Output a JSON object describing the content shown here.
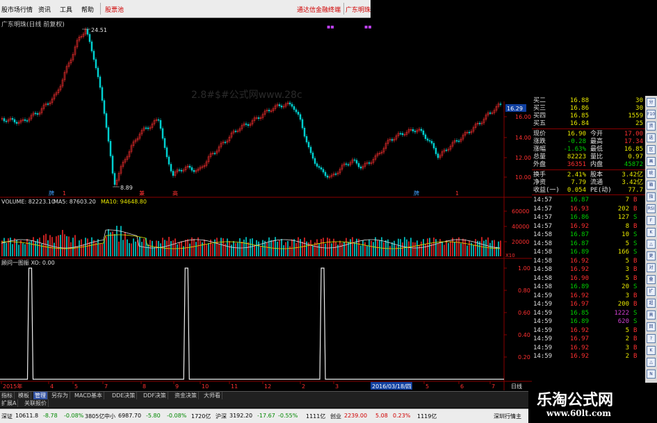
{
  "menubar": {
    "items": [
      "股市场行情",
      "资讯",
      "工具",
      "帮助"
    ],
    "stock_link": "股票池",
    "promo": "通达信金融终端",
    "app_title": "广东明珠"
  },
  "chart_header": {
    "title": "广东明珠(日线 前复权)"
  },
  "watermark_text": "2.8#$#公式网www.28c",
  "price_chart": {
    "high_label": "24.51",
    "low_label": "8.89",
    "current_price_tag": "16.29",
    "y_ticks": [
      "16.00",
      "14.00",
      "12.00",
      "10.00"
    ],
    "markers": [
      {
        "text": "牌",
        "color": "#40a0ff"
      },
      {
        "text": "1",
        "color": "#ff3030"
      },
      {
        "text": "兼",
        "color": "#ff3030"
      },
      {
        "text": "高",
        "color": "#ff3030"
      },
      {
        "text": "牌",
        "color": "#40a0ff"
      },
      {
        "text": "1",
        "color": "#ff3030"
      }
    ]
  },
  "volume_panel": {
    "header_volume": "VOLUME: 82223.10",
    "header_ma5": "MA5: 87603.20",
    "header_ma10": "MA10: 94648.80",
    "y_ticks": [
      "60000",
      "40000",
      "20000"
    ],
    "unit": "X10"
  },
  "indicator_panel": {
    "header": "顾问一图振 XO: 0.00",
    "y_ticks": [
      "1.00",
      "0.80",
      "0.60",
      "0.40",
      "0.20"
    ],
    "peaks": [
      0.06,
      0.37,
      0.64
    ]
  },
  "time_axis": {
    "labels": [
      "2015年",
      "4",
      "5",
      "7",
      "8",
      "9",
      "10",
      "11",
      "12",
      "2",
      "3",
      "2016/03/18/四",
      "5",
      "6",
      "7"
    ],
    "right_label": "日线"
  },
  "quote_panel": {
    "order_book": [
      {
        "label": "买二",
        "price": "16.88",
        "vol": "30"
      },
      {
        "label": "买三",
        "price": "16.86",
        "vol": "30"
      },
      {
        "label": "买四",
        "price": "16.85",
        "vol": "1559"
      },
      {
        "label": "买五",
        "price": "16.84",
        "vol": "25"
      }
    ],
    "stats": [
      {
        "l1": "现价",
        "v1": "16.90",
        "l2": "今开",
        "v2": "17.00"
      },
      {
        "l1": "涨跌",
        "v1": "-0.28",
        "l2": "最高",
        "v2": "17.34"
      },
      {
        "l1": "涨幅",
        "v1": "-1.63%",
        "l2": "最低",
        "v2": "16.85"
      },
      {
        "l1": "总量",
        "v1": "82223",
        "l2": "量比",
        "v2": "0.97"
      },
      {
        "l1": "外盘",
        "v1": "36351",
        "l2": "内盘",
        "v2": "45872"
      }
    ],
    "stats2": [
      {
        "l1": "换手",
        "v1": "2.41%",
        "l2": "股本",
        "v2": "3.42亿"
      },
      {
        "l1": "净资",
        "v1": "7.79",
        "l2": "流通",
        "v2": "3.42亿"
      },
      {
        "l1": "收益(一)",
        "v1": "0.054",
        "l2": "PE(动)",
        "v2": "77.7"
      }
    ],
    "ticks": [
      {
        "t": "14:57",
        "p": "16.87",
        "v": "7",
        "s": "B"
      },
      {
        "t": "14:57",
        "p": "16.93",
        "v": "202",
        "s": "B"
      },
      {
        "t": "14:57",
        "p": "16.86",
        "v": "127",
        "s": "S"
      },
      {
        "t": "14:57",
        "p": "16.92",
        "v": "8",
        "s": "B"
      },
      {
        "t": "14:58",
        "p": "16.87",
        "v": "10",
        "s": "S"
      },
      {
        "t": "14:58",
        "p": "16.87",
        "v": "5",
        "s": "S"
      },
      {
        "t": "14:58",
        "p": "16.89",
        "v": "166",
        "s": "S"
      },
      {
        "t": "14:58",
        "p": "16.92",
        "v": "5",
        "s": "B"
      },
      {
        "t": "14:58",
        "p": "16.92",
        "v": "3",
        "s": "B"
      },
      {
        "t": "14:58",
        "p": "16.90",
        "v": "5",
        "s": "B"
      },
      {
        "t": "14:58",
        "p": "16.89",
        "v": "20",
        "s": "S"
      },
      {
        "t": "14:59",
        "p": "16.92",
        "v": "3",
        "s": "B"
      },
      {
        "t": "14:59",
        "p": "16.97",
        "v": "200",
        "s": "B"
      },
      {
        "t": "14:59",
        "p": "16.85",
        "v": "1222",
        "s": "S"
      },
      {
        "t": "14:59",
        "p": "16.89",
        "v": "620",
        "s": "S"
      },
      {
        "t": "14:59",
        "p": "16.92",
        "v": "5",
        "s": "B"
      },
      {
        "t": "14:59",
        "p": "16.97",
        "v": "2",
        "s": "B"
      },
      {
        "t": "14:59",
        "p": "16.92",
        "v": "3",
        "s": "B"
      },
      {
        "t": "14:59",
        "p": "16.92",
        "v": "2",
        "s": "B"
      }
    ]
  },
  "side_icons": [
    "分",
    "F10",
    "资",
    "选",
    "区",
    "画",
    "统",
    "箱",
    "指",
    "RSI",
    "F",
    "K",
    "△",
    "更",
    "对",
    "叠",
    "扩",
    "超",
    "高",
    "回",
    "?",
    "K",
    "△",
    "N"
  ],
  "tabs_row1": [
    "指标",
    "模板",
    "管理",
    "另存为",
    "MACD基本",
    "DDE决策",
    "DDF决策",
    "资金决策",
    "大师看"
  ],
  "tabs_row1_active": 2,
  "tabs_row2": [
    "扩展A",
    "关联报价"
  ],
  "statusbar": {
    "items": [
      {
        "text": "深证",
        "cls": "k"
      },
      {
        "text": "10611.8",
        "cls": "k"
      },
      {
        "text": "-8.78",
        "cls": "g"
      },
      {
        "text": "-0.08%",
        "cls": "g"
      },
      {
        "text": "3805亿",
        "cls": "k"
      },
      {
        "text": "中小",
        "cls": "k"
      },
      {
        "text": "6987.70",
        "cls": "k"
      },
      {
        "text": "-5.80",
        "cls": "g"
      },
      {
        "text": "-0.08%",
        "cls": "g"
      },
      {
        "text": "1720亿",
        "cls": "k"
      },
      {
        "text": "沪深",
        "cls": "k"
      },
      {
        "text": "3192.20",
        "cls": "k"
      },
      {
        "text": "-17.67",
        "cls": "g"
      },
      {
        "text": "-0.55%",
        "cls": "g"
      },
      {
        "text": "1111亿",
        "cls": "k"
      },
      {
        "text": "创业",
        "cls": "k"
      },
      {
        "text": "2239.00",
        "cls": "r"
      },
      {
        "text": "5.08",
        "cls": "r"
      },
      {
        "text": "0.23%",
        "cls": "r"
      },
      {
        "text": "1119亿",
        "cls": "k"
      },
      {
        "text": "深圳行情主",
        "cls": "k"
      }
    ]
  },
  "banner": {
    "title": "乐淘公式网",
    "url": "www.60lt.com"
  },
  "colors": {
    "up": "#ff3030",
    "down": "#00d0d0",
    "axis": "#8a0000",
    "ma5": "#e0e0e0",
    "ma10": "#e8e800"
  }
}
